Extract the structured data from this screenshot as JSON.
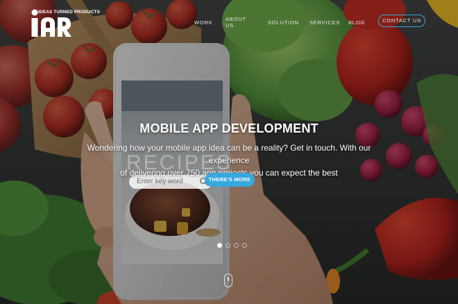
{
  "brand": {
    "name": "iar",
    "tagline": "IDEAS TURNED PRODUCTS",
    "logo_color": "#ffffff"
  },
  "nav": {
    "items": [
      "WORK",
      "ABOUT US",
      "SOLUTION",
      "SERVICES",
      "BLOG"
    ],
    "contact_label": "CONTACT US",
    "accent": "#37a8de"
  },
  "hero": {
    "title": "MOBILE APP DEVELOPMENT",
    "subtitle_line1": "Wondering how your mobile app idea can be a reality? Get in touch. With our experience",
    "subtitle_line2": "of delivering over 750 app projects you can expect the best",
    "cta_label": "THERE'S MORE",
    "cta_color": "#37a8de"
  },
  "phone_screen": {
    "search_placeholder": "Enter key word",
    "search_icon": "search-icon",
    "watermark": "RECIPES"
  },
  "slider": {
    "slide_count": 4,
    "active_index": 0
  },
  "scroll_indicator_icon": "mouse-scroll-icon"
}
